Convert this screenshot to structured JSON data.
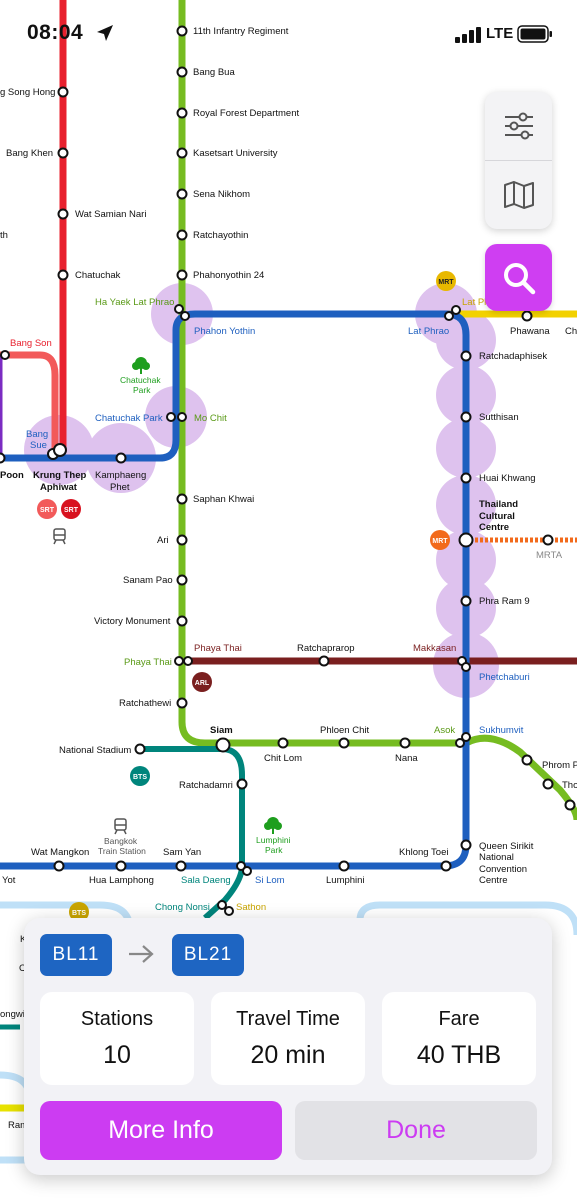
{
  "status_bar": {
    "time": "08:04",
    "network": "LTE"
  },
  "colors": {
    "srt_red": "#e8212e",
    "sukhumvit_green": "#76bc21",
    "mrt_blue": "#1e5fbf",
    "silom_teal": "#00857c",
    "arl_maroon": "#7a1f1f",
    "yellow_line": "#f2d100",
    "orange_line": "#f26a1b",
    "interchange": "#d9b8ec",
    "accent": "#cf3ef2",
    "route_code": "#1e65c2"
  },
  "icons": {
    "filter": "sliders-icon",
    "map": "map-icon",
    "search": "search-icon",
    "location": "location-arrow-icon",
    "park": "tree-icon",
    "train": "train-icon",
    "battery": "battery-icon",
    "signal": "signal-icon"
  },
  "map": {
    "stations_green_north": [
      "11th Infantry Regiment",
      "Bang Bua",
      "Royal Forest Department",
      "Kasetsart University",
      "Sena Nikhom",
      "Ratchayothin",
      "Phahonyothin 24"
    ],
    "stations_red_left": [
      "g Song Hong",
      "Bang Khen",
      "Wat Samian Nari",
      "th",
      "Chatuchak"
    ],
    "ha_yaek": "Ha Yaek Lat Phrao",
    "phahon_yothin": "Phahon Yothin",
    "lat_phrao": "Lat Phrao",
    "lat_phrao_yellow": "Lat Pl",
    "phawana": "Phawana",
    "cho": "Ch",
    "bang_son": "Bang Son",
    "chatuchak_park_label": [
      "Chatuchak",
      "Park"
    ],
    "chatuchak_park": "Chatuchak Park",
    "mo_chit": "Mo Chit",
    "bang_sue": [
      "Bang",
      "Sue"
    ],
    "krung_thep": [
      "Krung Thep",
      "Aphiwat"
    ],
    "poon": "Poon",
    "kamphaeng_phet": [
      "Kamphaeng",
      "Phet"
    ],
    "blue_east": [
      "Ratchadaphisek",
      "Sutthisan",
      "Huai Khwang"
    ],
    "thailand_cultural": [
      "Thailand",
      "Cultural",
      "Centre"
    ],
    "mrta": "MRTA",
    "phra_ram_9": "Phra Ram 9",
    "green_south": [
      "Saphan Khwai",
      "Ari",
      "Sanam Pao",
      "Victory Monument"
    ],
    "phaya_thai": "Phaya Thai",
    "phaya_thai_arl": "Phaya Thai",
    "ratchaprarop": "Ratchaprarop",
    "makkasan": "Makkasan",
    "phetchaburi": "Phetchaburi",
    "ratchathewi": "Ratchathewi",
    "siam": "Siam",
    "phloen_chit": "Phloen Chit",
    "chit_lom": "Chit Lom",
    "asok": "Asok",
    "sukhumvit": "Sukhumvit",
    "nana": "Nana",
    "phrom": "Phrom P",
    "tho": "Tho",
    "national_stadium": "National Stadium",
    "ratchadamri": "Ratchadamri",
    "bangkok_train_station": [
      "Bangkok",
      "Train Station"
    ],
    "lumphini_park": [
      "Lumphini",
      "Park"
    ],
    "wat_mangkon": "Wat Mangkon",
    "sam_yan": "Sam Yan",
    "khlong_toei": "Khlong Toei",
    "queen_sirikit": [
      "Queen Sirikit",
      "National",
      "Convention",
      "Centre"
    ],
    "yot": "Yot",
    "hua_lamphong": "Hua Lamphong",
    "sala_daeng": "Sala Daeng",
    "si_lom": "Si Lom",
    "lumphini": "Lumphini",
    "chong_nonsi": "Chong Nonsi",
    "sathon": "Sathon",
    "ongwi": "ongwi",
    "ram": "Ram",
    "k_label": "K",
    "c_label": "C",
    "badges": {
      "mrt": "MRT",
      "srt": "SRT",
      "arl": "ARL",
      "bts": "BTS"
    }
  },
  "route": {
    "from_code": "BL11",
    "to_code": "BL21",
    "stats": [
      {
        "label": "Stations",
        "value": "10"
      },
      {
        "label": "Travel Time",
        "value": "20 min"
      },
      {
        "label": "Fare",
        "value": "40 THB"
      }
    ],
    "more_info_label": "More Info",
    "done_label": "Done"
  }
}
